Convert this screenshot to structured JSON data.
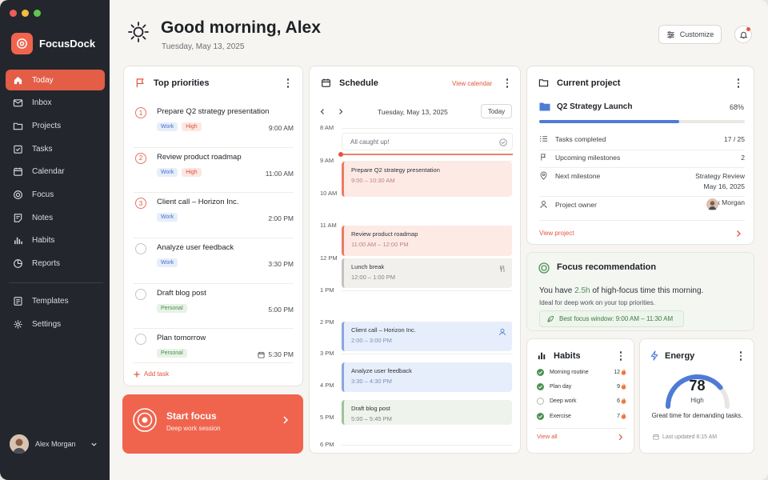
{
  "app": {
    "name": "FocusDock"
  },
  "sidebar": {
    "items": [
      {
        "label": "Today",
        "icon": "home-icon",
        "active": true
      },
      {
        "label": "Inbox",
        "icon": "inbox-icon"
      },
      {
        "label": "Projects",
        "icon": "folder-icon"
      },
      {
        "label": "Tasks",
        "icon": "tasks-icon"
      },
      {
        "label": "Calendar",
        "icon": "calendar-icon"
      },
      {
        "label": "Focus",
        "icon": "focus-icon"
      },
      {
        "label": "Notes",
        "icon": "notes-icon"
      },
      {
        "label": "Habits",
        "icon": "habits-icon"
      },
      {
        "label": "Reports",
        "icon": "reports-icon"
      }
    ],
    "secondary": [
      {
        "label": "Templates",
        "icon": "templates-icon"
      },
      {
        "label": "Settings",
        "icon": "gear-icon"
      }
    ],
    "user": {
      "name": "Alex Morgan"
    }
  },
  "header": {
    "greeting": "Good morning, Alex",
    "date": "Tuesday, May 13, 2025",
    "customize_label": "Customize"
  },
  "priorities": {
    "title": "Top priorities",
    "items": [
      {
        "num": "1",
        "title": "Prepare Q2 strategy presentation",
        "tags": [
          "Work",
          "High"
        ],
        "time": "9:00 AM"
      },
      {
        "num": "2",
        "title": "Review product roadmap",
        "tags": [
          "Work",
          "High"
        ],
        "time": "11:00 AM"
      },
      {
        "num": "3",
        "title": "Client call – Horizon Inc.",
        "tags": [
          "Work"
        ],
        "time": "2:00 PM"
      },
      {
        "num": "",
        "title": "Analyze user feedback",
        "tags": [
          "Work"
        ],
        "time": "3:30 PM"
      },
      {
        "num": "",
        "title": "Draft blog post",
        "tags": [
          "Personal"
        ],
        "time": "5:00 PM"
      },
      {
        "num": "",
        "title": "Plan tomorrow",
        "tags": [
          "Personal"
        ],
        "time": "5:30 PM"
      }
    ],
    "add_label": "Add task"
  },
  "start_focus": {
    "title": "Start focus",
    "subtitle": "Deep work session"
  },
  "schedule": {
    "title": "Schedule",
    "view_calendar": "View calendar",
    "date": "Tuesday, May 13, 2025",
    "today_label": "Today",
    "hours": [
      "8 AM",
      "9 AM",
      "10 AM",
      "11 AM",
      "12 PM",
      "1 PM",
      "2 PM",
      "3 PM",
      "4 PM",
      "5 PM",
      "6 PM"
    ],
    "caught_up": "All caught up!",
    "events": [
      {
        "title": "Prepare Q2 strategy presentation",
        "time": "9:00 – 10:30 AM",
        "color": "red"
      },
      {
        "title": "Review product roadmap",
        "time": "11:00 AM – 12:00 PM",
        "color": "red"
      },
      {
        "title": "Lunch break",
        "time": "12:00 – 1:00 PM",
        "color": "gray"
      },
      {
        "title": "Client call – Horizon Inc.",
        "time": "2:00 – 3:00 PM",
        "color": "blue"
      },
      {
        "title": "Analyze user feedback",
        "time": "3:30 – 4:30 PM",
        "color": "blue"
      },
      {
        "title": "Draft blog post",
        "time": "5:00 – 5:45 PM",
        "color": "green"
      }
    ]
  },
  "project": {
    "title": "Current project",
    "name": "Q2 Strategy Launch",
    "progress_pct": "68%",
    "progress_value": 0.68,
    "rows": [
      {
        "label": "Tasks completed",
        "value": "17 / 25"
      },
      {
        "label": "Upcoming milestones",
        "value": "2"
      },
      {
        "label": "Next milestone",
        "value": "Strategy Review",
        "value2": "May 16, 2025"
      },
      {
        "label": "Project owner",
        "value": "Alex Morgan"
      }
    ],
    "view_label": "View project"
  },
  "focus_rec": {
    "title": "Focus recommendation",
    "text_pre": "You have ",
    "text_hl": "2.5h",
    "text_post": " of high-focus time this morning.",
    "sub": "Ideal for deep work on your top priorities.",
    "pill": "Best focus window: 9:00 AM – 11:30 AM"
  },
  "habits": {
    "title": "Habits",
    "items": [
      {
        "label": "Morning routine",
        "streak": "12",
        "done": true
      },
      {
        "label": "Plan day",
        "streak": "9",
        "done": true
      },
      {
        "label": "Deep work",
        "streak": "6",
        "done": false
      },
      {
        "label": "Exercise",
        "streak": "7",
        "done": true
      }
    ],
    "view_all": "View all"
  },
  "energy": {
    "title": "Energy",
    "value": "78",
    "level": "High",
    "note": "Great time for demanding tasks.",
    "updated": "Last updated 8:15 AM",
    "gauge_fraction": 0.78
  },
  "colors": {
    "accent": "#f0644e",
    "sidebar": "#23272d",
    "blue": "#4f7bd6",
    "green": "#4f9154"
  }
}
